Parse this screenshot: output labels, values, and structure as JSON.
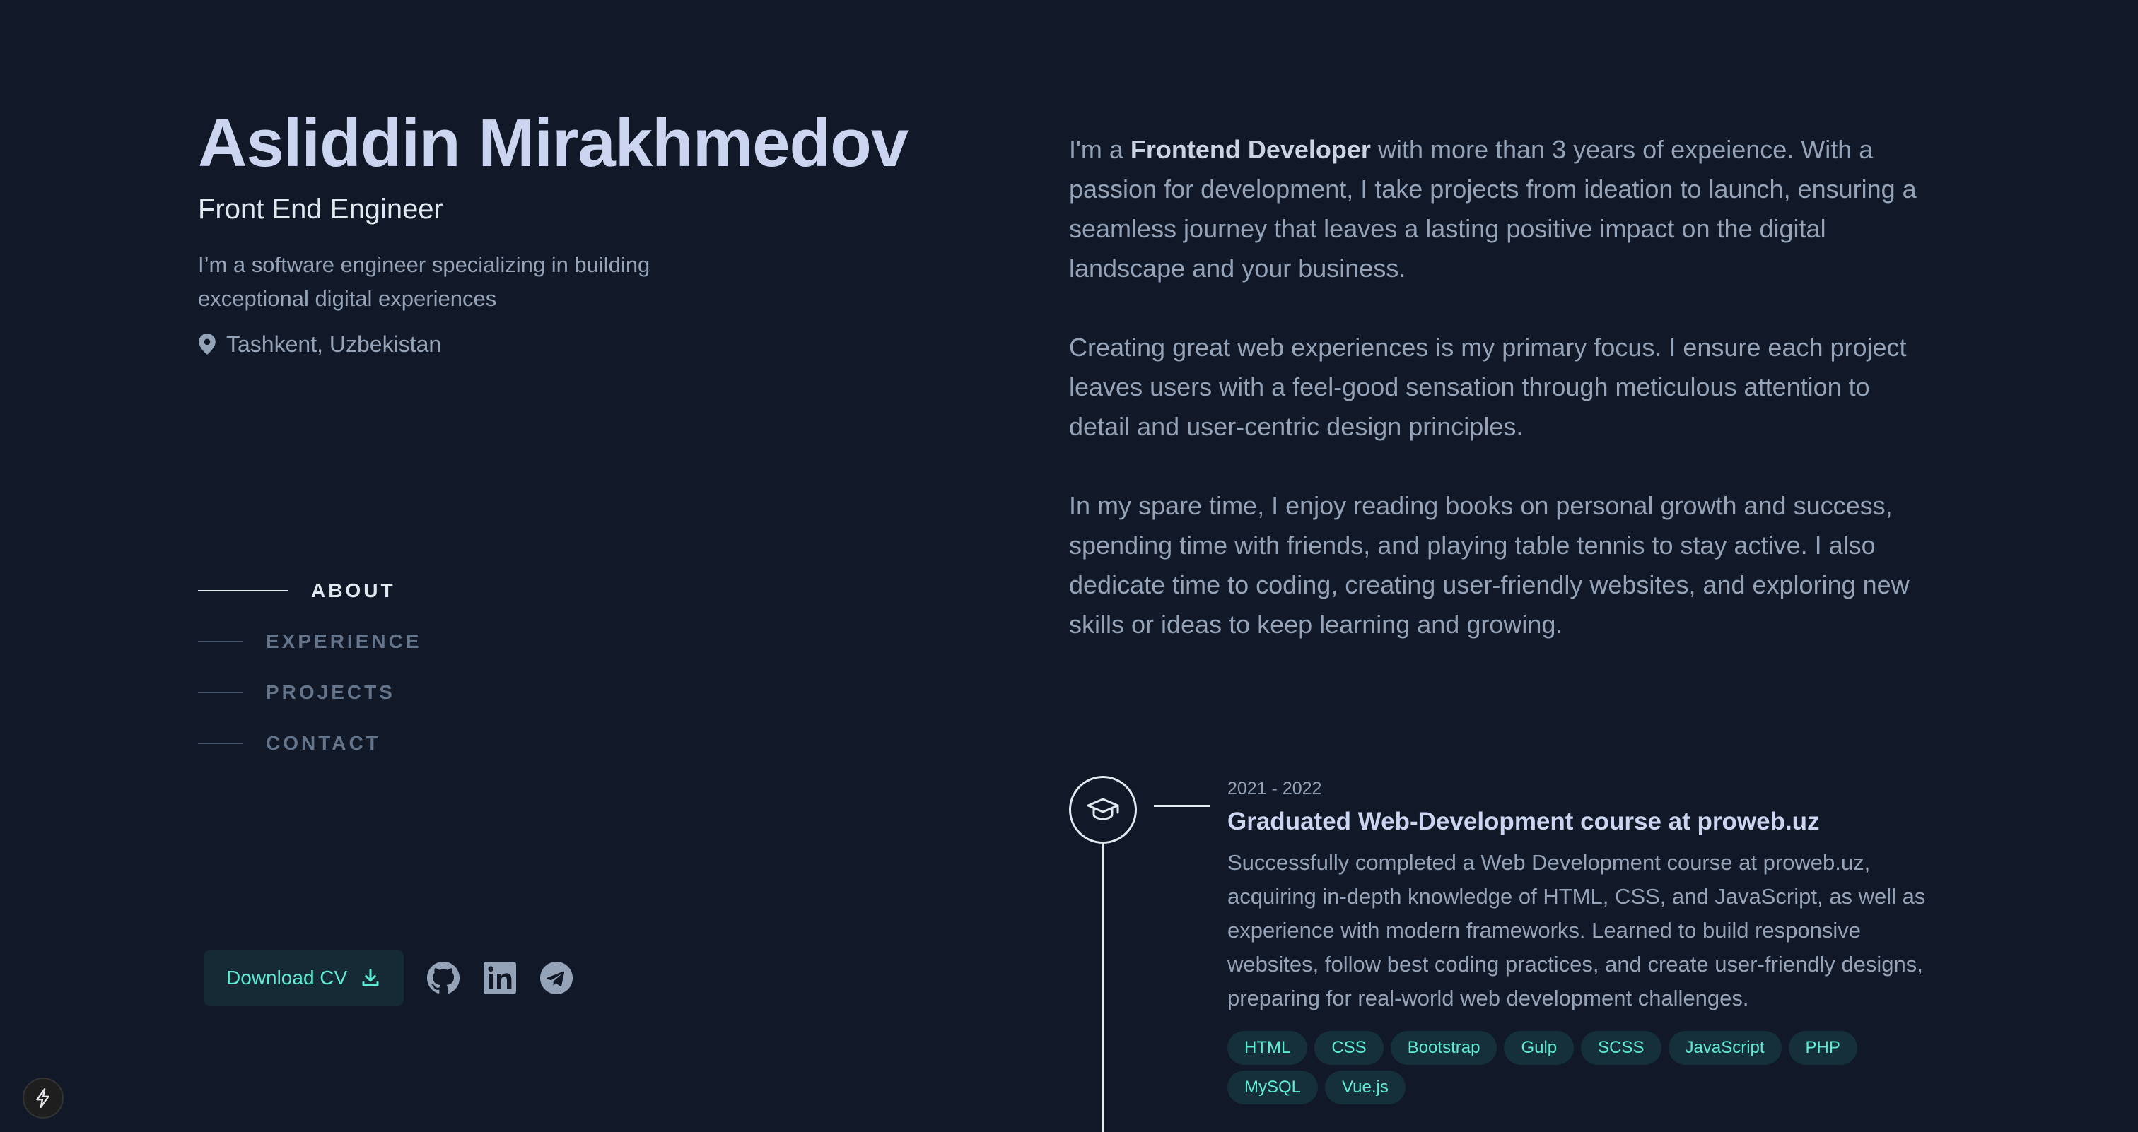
{
  "profile": {
    "name": "Asliddin Mirakhmedov",
    "role": "Front End Engineer",
    "tagline": "I’m a software engineer specializing in building exceptional digital experiences",
    "location": "Tashkent, Uzbekistan",
    "location_icon": "map-pin-icon"
  },
  "nav": {
    "items": [
      {
        "label": "ABOUT",
        "active": true
      },
      {
        "label": "EXPERIENCE",
        "active": false
      },
      {
        "label": "PROJECTS",
        "active": false
      },
      {
        "label": "CONTACT",
        "active": false
      }
    ]
  },
  "actions": {
    "download_cv_label": "Download CV",
    "download_icon": "download-icon",
    "socials": [
      "github-icon",
      "linkedin-icon",
      "telegram-icon"
    ]
  },
  "about": {
    "p1_prefix": "I'm a ",
    "p1_strong": "Frontend Developer",
    "p1_suffix": " with more than 3 years of expeience. With a passion for development, I take projects from ideation to launch, ensuring a seamless journey that leaves a lasting positive impact on the digital landscape and your business.",
    "p2": "Creating great web experiences is my primary focus. I ensure each project leaves users with a feel-good sensation through meticulous attention to detail and user-centric design principles.",
    "p3": "In my spare time, I enjoy reading books on personal growth and success, spending time with friends, and playing table tennis to stay active. I also dedicate time to coding, creating user-friendly websites, and exploring new skills or ideas to keep learning and growing."
  },
  "timeline": {
    "icon": "graduation-cap-icon",
    "entry": {
      "date": "2021 - 2022",
      "title": "Graduated Web-Development course at proweb.uz",
      "description": "Successfully completed a Web Development course at proweb.uz, acquiring in-depth knowledge of HTML, CSS, and JavaScript, as well as experience with modern frameworks. Learned to build responsive websites, follow best coding practices, and create user-friendly designs, preparing for real-world web development challenges.",
      "tags": [
        "HTML",
        "CSS",
        "Bootstrap",
        "Gulp",
        "SCSS",
        "JavaScript",
        "PHP",
        "MySQL",
        "Vue.js"
      ]
    }
  },
  "floating_button_icon": "lightning-bolt-icon",
  "colors": {
    "background": "#111827",
    "accent": "#5eead4",
    "heading": "#cbd5f0",
    "body_text": "#94a3b8"
  }
}
